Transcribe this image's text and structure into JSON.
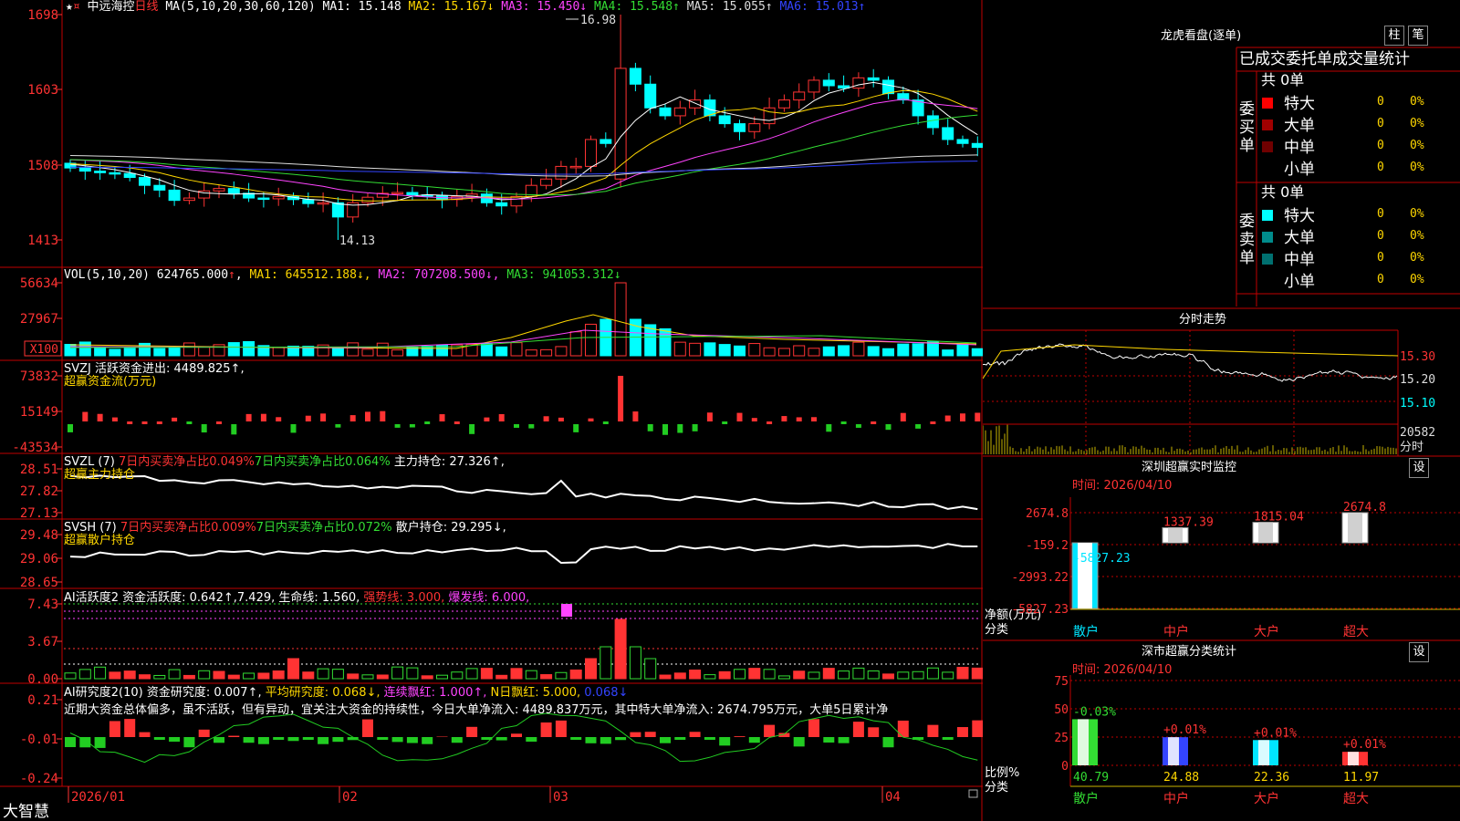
{
  "stock": {
    "star": "★",
    "name": "中远海控",
    "period": "日线",
    "ma_params": "MA(5,10,20,30,60,120)",
    "ma": [
      {
        "label": "MA1:",
        "value": "15.148",
        "arrow": "",
        "color": "#ffffff"
      },
      {
        "label": "MA2:",
        "value": "15.167",
        "arrow": "↓",
        "color": "#ffd700"
      },
      {
        "label": "MA3:",
        "value": "15.450",
        "arrow": "↓",
        "color": "#ff44ff"
      },
      {
        "label": "MA4:",
        "value": "15.548",
        "arrow": "↑",
        "color": "#33dd33"
      },
      {
        "label": "MA5:",
        "value": "15.055",
        "arrow": "↑",
        "color": "#dddddd"
      },
      {
        "label": "MA6:",
        "value": "15.013",
        "arrow": "↑",
        "color": "#3344ff"
      }
    ],
    "price_axis": [
      "1698",
      "1603",
      "1508",
      "1413"
    ],
    "high_mark": "16.98",
    "low_mark": "14.13"
  },
  "volume": {
    "header": "VOL(5,10,20)",
    "value": "624765.000",
    "ma1": "645512.188",
    "ma2": "707208.500",
    "ma3": "941053.312",
    "axis": [
      "56634",
      "27967",
      "X100"
    ]
  },
  "svzj": {
    "header": "SVZJ  活跃资金进出: 4489.825↑,",
    "sub": "超赢资金流(万元)",
    "axis": [
      "73832",
      "15149",
      "-43534"
    ]
  },
  "svzl": {
    "prefix": "SVZL (7)",
    "a": "7日内买卖净占比0.049%",
    "b": "7日内买卖净占比0.064%",
    "c": "主力持仓: 27.326↑,",
    "sub": "超赢主力持仓",
    "axis": [
      "28.51",
      "27.82",
      "27.13"
    ]
  },
  "svsh": {
    "prefix": "SVSH (7)",
    "a": "7日内买卖净占比0.009%",
    "b": "7日内买卖净占比0.072%",
    "c": "散户持仓: 29.295↓,",
    "sub": "超赢散户持仓",
    "axis": [
      "29.48",
      "29.06",
      "28.65"
    ]
  },
  "ai_active": {
    "prefix": "AI活跃度2",
    "a": "资金活跃度: 0.642↑,7.429,",
    "b": "生命线: 1.560,",
    "c": "强势线: 3.000,",
    "d": "爆发线: 6.000,",
    "axis": [
      "7.43",
      "3.67",
      "0.00"
    ]
  },
  "ai_research": {
    "prefix": "AI研究度2(10)",
    "a": "资金研究度: 0.007↑,",
    "b": "平均研究度: 0.068↓,",
    "c": "连续飘红: 1.000↑,",
    "d": "N日飘红: 5.000,",
    "e": "0.068↓",
    "comment": "近期大资金总体偏多，虽不活跃，但有异动，宜关注大资金的持续性，今日大单净流入: 4489.837万元，其中特大单净流入: 2674.795万元，大单5日累计净",
    "axis": [
      "0.21",
      "-0.01",
      "-0.24"
    ]
  },
  "footer": {
    "brand": "大智慧",
    "dates": [
      "2026/01",
      "02",
      "03",
      "04"
    ]
  },
  "right": {
    "title": "龙虎看盘(逐单)",
    "btn1": "柱",
    "btn2": "笔",
    "stats_title": "已成交委托单成交量统计",
    "buy": {
      "label": "委买单",
      "total": "共 0单",
      "rows": [
        {
          "name": "特大",
          "count": "0",
          "pct": "0%",
          "color": "#ff0000"
        },
        {
          "name": "大单",
          "count": "0",
          "pct": "0%",
          "color": "#a00000"
        },
        {
          "name": "中单",
          "count": "0",
          "pct": "0%",
          "color": "#700000"
        },
        {
          "name": "小单",
          "count": "0",
          "pct": "0%",
          "color": ""
        }
      ]
    },
    "sell": {
      "label": "委卖单",
      "total": "共 0单",
      "rows": [
        {
          "name": "特大",
          "count": "0",
          "pct": "0%",
          "color": "#00ffff"
        },
        {
          "name": "大单",
          "count": "0",
          "pct": "0%",
          "color": "#008b8b"
        },
        {
          "name": "中单",
          "count": "0",
          "pct": "0%",
          "color": "#007070"
        },
        {
          "name": "小单",
          "count": "0",
          "pct": "0%",
          "color": ""
        }
      ]
    },
    "intraday": {
      "title": "分时走势",
      "axis": [
        "15.30",
        "15.20",
        "15.10"
      ],
      "vol": "20582",
      "vol_label": "分时"
    },
    "sz_monitor": {
      "title": "深圳超赢实时监控",
      "btn": "设",
      "time": "时间: 2026/04/10",
      "axis": [
        "2674.8",
        "-159.2",
        "-2993.22",
        "-5827.23"
      ],
      "ylabel1": "净额(万元)",
      "ylabel2": "分类",
      "values": [
        "-5827.23",
        "1337.39",
        "1815.04",
        "2674.8"
      ],
      "cats": [
        "散户",
        "中户",
        "大户",
        "超大"
      ]
    },
    "sz_class": {
      "title": "深市超赢分类统计",
      "btn": "设",
      "time": "时间: 2026/04/10",
      "axis": [
        "75",
        "50",
        "25",
        "0"
      ],
      "ylabel1": "比例%",
      "ylabel2": "分类",
      "changes": [
        "-0.03%",
        "+0.01%",
        "+0.01%",
        "+0.01%"
      ],
      "values": [
        "40.79",
        "24.88",
        "22.36",
        "11.97"
      ],
      "cats": [
        "散户",
        "中户",
        "大户",
        "超大"
      ]
    }
  },
  "colors": {
    "up": "#ff3333",
    "down": "#00ffff",
    "grid": "#c00000"
  }
}
